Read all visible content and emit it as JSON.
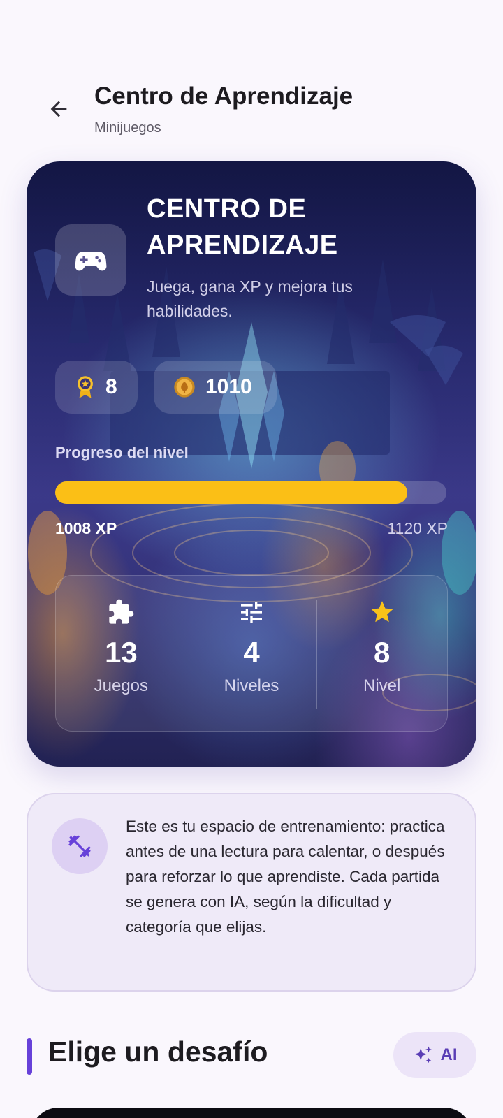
{
  "header": {
    "title": "Centro de Aprendizaje",
    "subtitle": "Minijuegos",
    "back_icon": "arrow-back-icon"
  },
  "hero": {
    "icon": "gamepad-icon",
    "title": "CENTRO DE APRENDIZAJE",
    "subtitle": "Juega, gana XP y mejora tus habilidades.",
    "medals": {
      "icon": "medal-icon",
      "value": "8"
    },
    "coins": {
      "icon": "coin-icon",
      "value": "1010"
    },
    "progress": {
      "label": "Progreso del nivel",
      "current": "1008 XP",
      "max": "1120 XP",
      "fraction": 0.9
    },
    "stats": [
      {
        "icon": "puzzle-icon",
        "value": "13",
        "label": "Juegos"
      },
      {
        "icon": "sliders-icon",
        "value": "4",
        "label": "Niveles"
      },
      {
        "icon": "star-icon",
        "value": "8",
        "label": "Nivel"
      }
    ]
  },
  "info": {
    "icon": "dumbbell-icon",
    "text": "Este es tu espacio de entrenamiento: practica antes de una lectura para calentar, o después para reforzar lo que aprendiste. Cada partida se genera con IA, según la dificultad y categoría que elijas."
  },
  "section": {
    "title": "Elige un desafío",
    "ai_button": {
      "icon": "sparkles-icon",
      "label": "AI"
    }
  },
  "colors": {
    "accent": "#6741d9",
    "progress": "#fbbf16",
    "background": "#faf7fd"
  }
}
